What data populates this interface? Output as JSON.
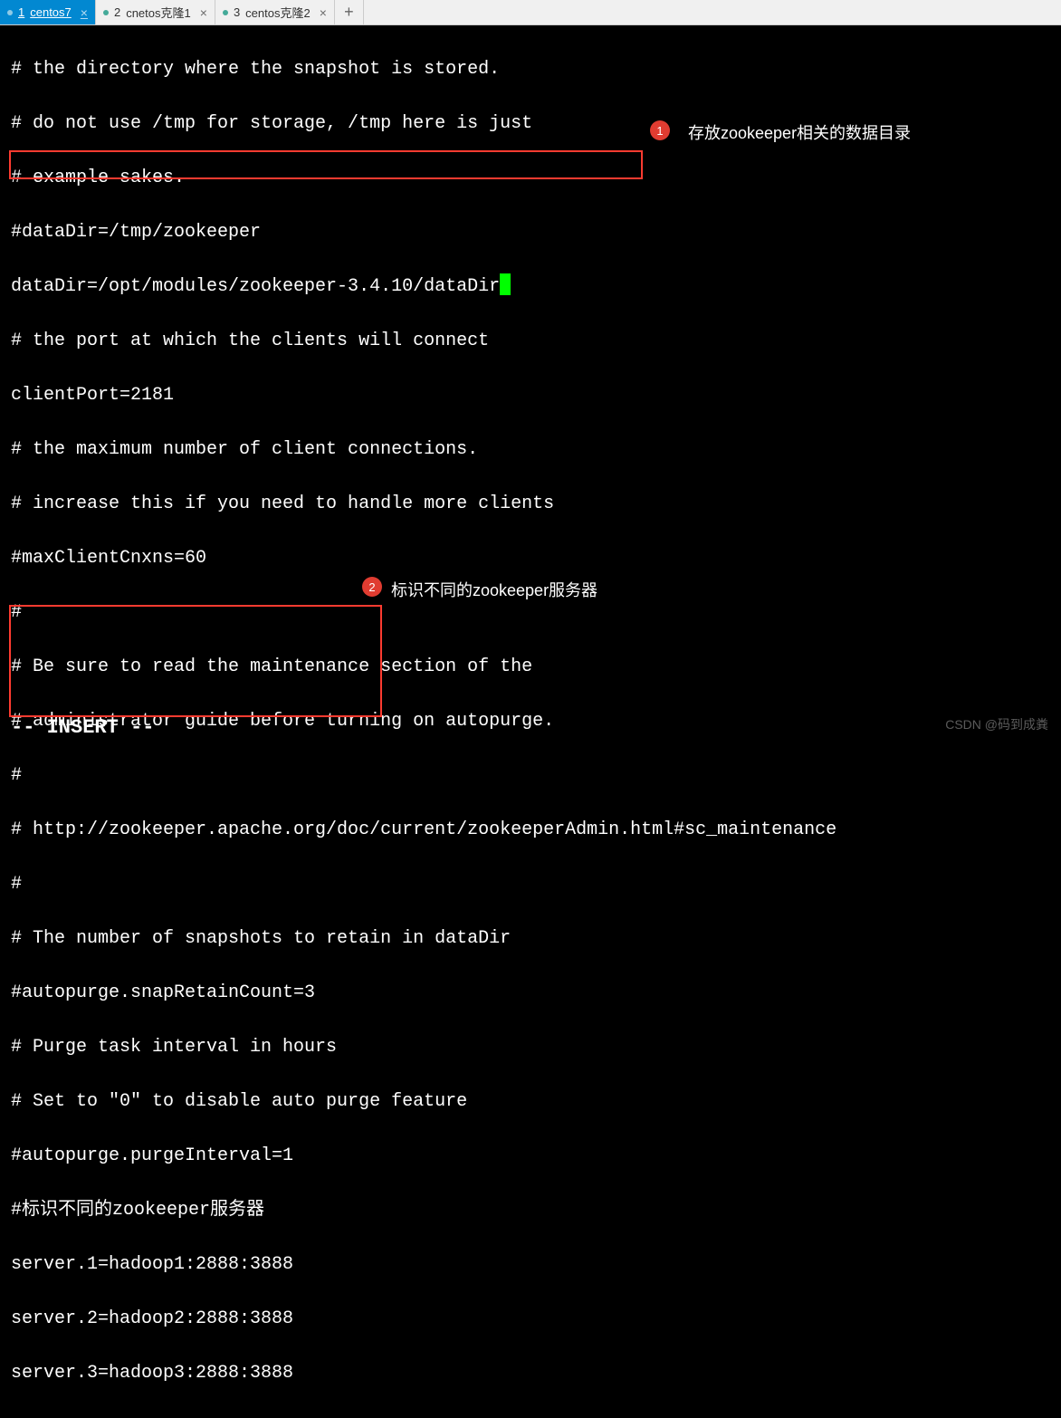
{
  "tabs": {
    "items": [
      {
        "index": "1",
        "label": "centos7",
        "active": true
      },
      {
        "index": "2",
        "label": "cnetos克隆1",
        "active": false
      },
      {
        "index": "3",
        "label": "centos克隆2",
        "active": false
      }
    ],
    "add_symbol": "+"
  },
  "file": {
    "lines": {
      "l1": "# the directory where the snapshot is stored.",
      "l2": "# do not use /tmp for storage, /tmp here is just",
      "l3": "# example sakes.",
      "l4": "#dataDir=/tmp/zookeeper",
      "l5": "dataDir=/opt/modules/zookeeper-3.4.10/dataDir",
      "l6": "# the port at which the clients will connect",
      "l7": "clientPort=2181",
      "l8": "# the maximum number of client connections.",
      "l9": "# increase this if you need to handle more clients",
      "l10": "#maxClientCnxns=60",
      "l11": "#",
      "l12": "# Be sure to read the maintenance section of the",
      "l13": "# administrator guide before turning on autopurge.",
      "l14": "#",
      "l15": "# http://zookeeper.apache.org/doc/current/zookeeperAdmin.html#sc_maintenance",
      "l16": "#",
      "l17": "# The number of snapshots to retain in dataDir",
      "l18": "#autopurge.snapRetainCount=3",
      "l19": "# Purge task interval in hours",
      "l20": "# Set to \"0\" to disable auto purge feature",
      "l21": "#autopurge.purgeInterval=1",
      "l22": "#标识不同的zookeeper服务器",
      "l23": "server.1=hadoop1:2888:3888",
      "l24": "server.2=hadoop2:2888:3888",
      "l25": "server.3=hadoop3:2888:3888"
    }
  },
  "annotations": {
    "badge1": "1",
    "text1": "存放zookeeper相关的数据目录",
    "badge2": "2",
    "text2": "标识不同的zookeeper服务器"
  },
  "status": "-- INSERT --",
  "watermark": "CSDN @码到成粪"
}
